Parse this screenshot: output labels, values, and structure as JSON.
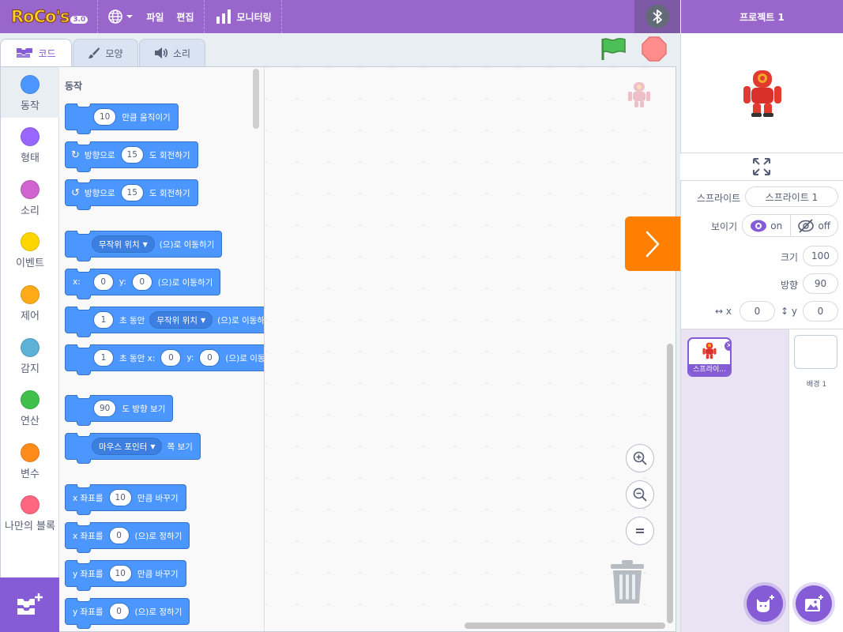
{
  "menubar": {
    "logo_text": "RoCo's",
    "logo_version": "3.0",
    "file_label": "파일",
    "edit_label": "편집",
    "monitoring_label": "모니터링",
    "project_title": "프로젝트 1",
    "bluetooth_icon": "bluetooth-icon",
    "language_icon": "globe-icon"
  },
  "tabs": {
    "code": "코드",
    "costumes": "모양",
    "sounds": "소리",
    "active": "code"
  },
  "categories": [
    {
      "label": "동작",
      "color": "#4c97ff",
      "active": true
    },
    {
      "label": "형태",
      "color": "#9966ff",
      "active": false
    },
    {
      "label": "소리",
      "color": "#cf63cf",
      "active": false
    },
    {
      "label": "이벤트",
      "color": "#ffd500",
      "active": false
    },
    {
      "label": "제어",
      "color": "#ffab19",
      "active": false
    },
    {
      "label": "감지",
      "color": "#5cb1d6",
      "active": false
    },
    {
      "label": "연산",
      "color": "#40bf4a",
      "active": false
    },
    {
      "label": "변수",
      "color": "#ff8c1a",
      "active": false
    },
    {
      "label": "나만의 블록",
      "color": "#ff6680",
      "active": false
    }
  ],
  "flyout": {
    "title": "동작",
    "blocks": {
      "move": {
        "value": "10",
        "text": "만큼 움직이기"
      },
      "turn_right": {
        "pre": "방향으로",
        "value": "15",
        "post": "도 회전하기"
      },
      "turn_left": {
        "pre": "방향으로",
        "value": "15",
        "post": "도 회전하기"
      },
      "goto": {
        "dropdown": "무작위 위치",
        "post": "(으)로 이동하기"
      },
      "goto_xy": {
        "x_label": "x:",
        "x": "0",
        "y_label": "y:",
        "y": "0",
        "post": "(으)로 이동하기"
      },
      "glide": {
        "secs": "1",
        "mid": "초 동안",
        "dropdown": "무작위 위치",
        "post": "(으)로 이동하기"
      },
      "glide_xy": {
        "secs": "1",
        "mid": "초 동안 x:",
        "x": "0",
        "y_label": "y:",
        "y": "0",
        "post": "(으)로 이동하기"
      },
      "point_dir": {
        "value": "90",
        "post": "도 방향 보기"
      },
      "point_towards": {
        "dropdown": "마우스 포인터",
        "post": "쪽 보기"
      },
      "change_x": {
        "pre": "x 좌표를",
        "value": "10",
        "post": "만큼 바꾸기"
      },
      "set_x": {
        "pre": "x 좌표를",
        "value": "0",
        "post": "(으)로 정하기"
      },
      "change_y": {
        "pre": "y 좌표를",
        "value": "10",
        "post": "만큼 바꾸기"
      },
      "set_y": {
        "pre": "y 좌표를",
        "value": "0",
        "post": "(으)로 정하기"
      }
    }
  },
  "sprite_info": {
    "sprite_label": "스프라이트",
    "sprite_name": "스프라이트 1",
    "show_label": "보이기",
    "on_label": "on",
    "off_label": "off",
    "size_label": "크기",
    "size": "100",
    "direction_label": "방향",
    "direction": "90",
    "x_label": "x",
    "x": "0",
    "y_label": "y",
    "y": "0"
  },
  "sprite_list": [
    {
      "name": "스프라이트 1",
      "display": "스프라이..."
    }
  ],
  "backdrop": {
    "label": "배경 1"
  },
  "colors": {
    "menubar": "#9966cc",
    "motion": "#4c97ff",
    "accent": "#855cd6",
    "toggle": "#ff8000"
  }
}
